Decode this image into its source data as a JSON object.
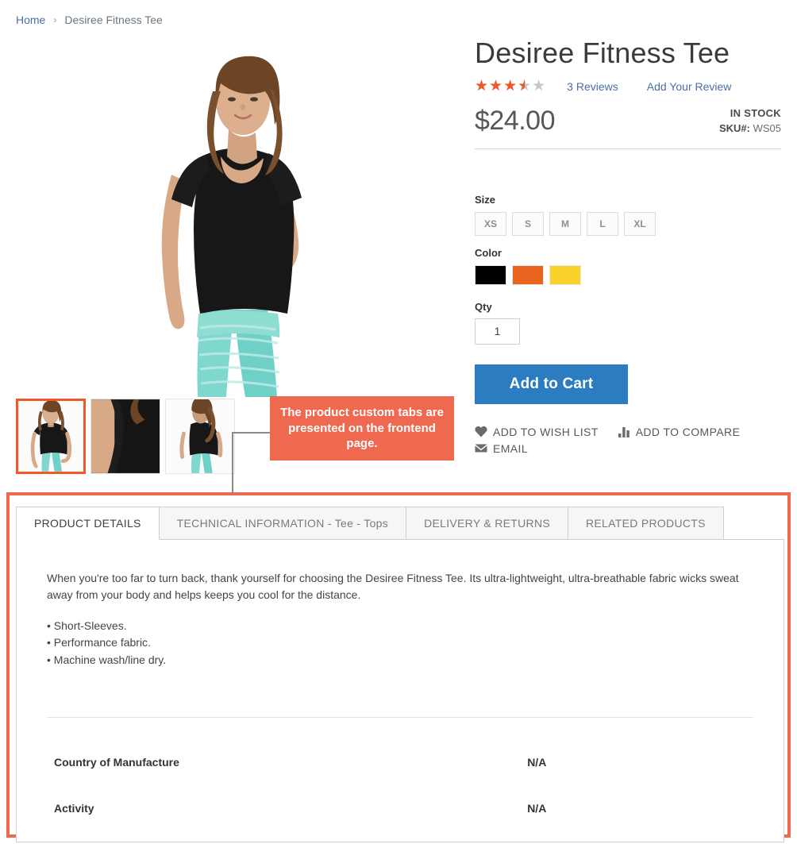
{
  "breadcrumb": {
    "home": "Home",
    "separator": "›",
    "current": "Desiree Fitness Tee"
  },
  "product": {
    "title": "Desiree Fitness Tee",
    "rating_percent": 70,
    "stars_glyphs": "★★★★★",
    "reviews_link": "3  Reviews",
    "add_review_link": "Add Your Review",
    "price": "$24.00",
    "stock_status": "IN STOCK",
    "sku_label": "SKU#:",
    "sku_value": "WS05"
  },
  "options": {
    "size_label": "Size",
    "sizes": [
      "XS",
      "S",
      "M",
      "L",
      "XL"
    ],
    "color_label": "Color",
    "colors": [
      {
        "name": "black",
        "hex": "#000000"
      },
      {
        "name": "orange",
        "hex": "#e8651f"
      },
      {
        "name": "yellow",
        "hex": "#f9d22b"
      }
    ],
    "qty_label": "Qty",
    "qty_value": "1",
    "add_to_cart": "Add to Cart"
  },
  "actions": [
    {
      "icon": "heart-icon",
      "label": "ADD TO WISH LIST"
    },
    {
      "icon": "compare-bars-icon",
      "label": "ADD TO COMPARE"
    },
    {
      "icon": "envelope-icon",
      "label": "EMAIL"
    }
  ],
  "annotation": {
    "text": "The product custom tabs are presented on the frontend page.",
    "color": "#ee6950"
  },
  "tabs": [
    {
      "label": "PRODUCT DETAILS",
      "active": true
    },
    {
      "label": "TECHNICAL INFORMATION - Tee - Tops",
      "active": false
    },
    {
      "label": "DELIVERY & RETURNS",
      "active": false
    },
    {
      "label": "RELATED PRODUCTS",
      "active": false
    }
  ],
  "details": {
    "description": "When you're too far to turn back, thank yourself for choosing the Desiree Fitness Tee. Its ultra-lightweight, ultra-breathable fabric wicks sweat away from your body and helps keeps you cool for the distance.",
    "features": [
      "• Short-Sleeves.",
      "• Performance fabric.",
      "• Machine wash/line dry."
    ],
    "attributes": [
      {
        "name": "Country of Manufacture",
        "value": "N/A"
      },
      {
        "name": "Activity",
        "value": "N/A"
      }
    ]
  },
  "theme": {
    "accent": "#f0572b",
    "link": "#4a6fa5",
    "button": "#2b7cc0"
  }
}
